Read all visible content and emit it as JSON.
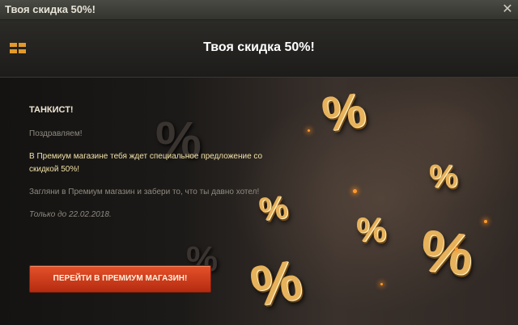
{
  "window": {
    "title": "Твоя скидка 50%!",
    "close_label": "✕"
  },
  "header": {
    "title": "Твоя скидка 50%!",
    "menu_icon": "grid-menu-icon"
  },
  "message": {
    "greeting": "ТАНКИСТ!",
    "congrats": "Поздравляем!",
    "offer": "В Премиум магазине тебя ждет специальное предложение со скидкой 50%!",
    "invite": "Загляни в Премиум магазин и забери то, что ты давно хотел!",
    "until": "Только до 22.02.2018."
  },
  "button": {
    "label": "ПЕРЕЙТИ В ПРЕМИУМ МАГАЗИН!"
  },
  "decor": {
    "percent_symbol": "%"
  },
  "colors": {
    "accent": "#e39a2b",
    "button": "#d8411d",
    "offer_text": "#f1e1a6"
  }
}
